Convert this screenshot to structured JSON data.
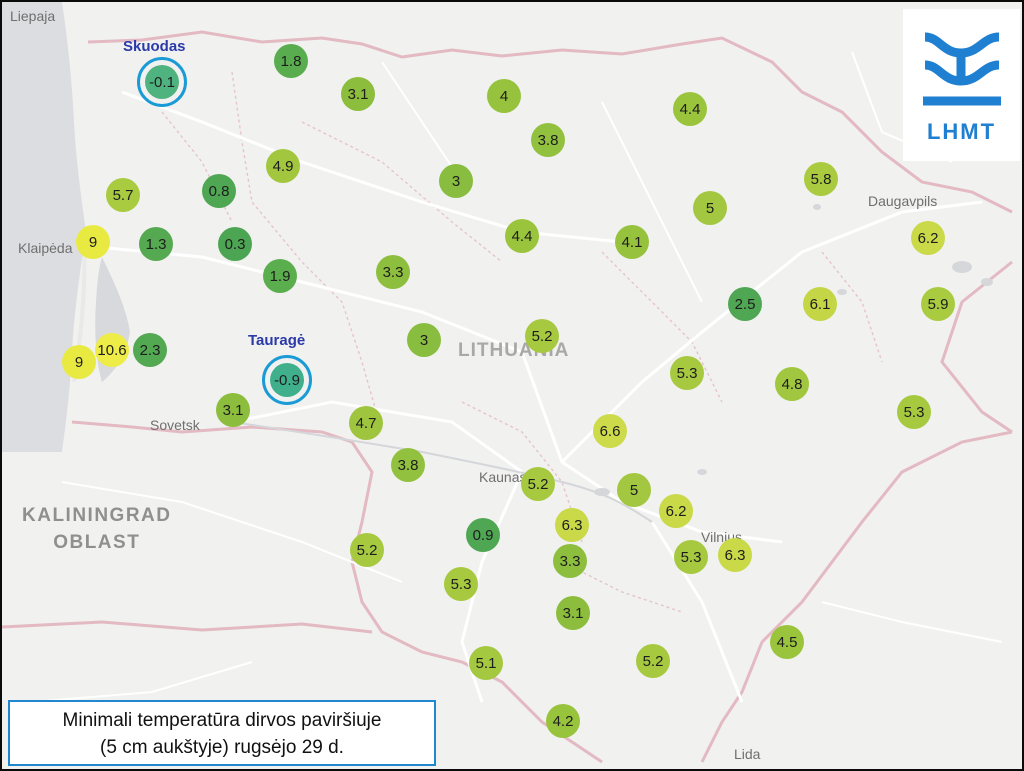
{
  "map": {
    "places": [
      {
        "name": "Liepaja",
        "kind": "city"
      },
      {
        "name": "Klaipėda",
        "kind": "city"
      },
      {
        "name": "Sovetsk",
        "kind": "city"
      },
      {
        "name": "Kaunas",
        "kind": "city"
      },
      {
        "name": "Vilnius",
        "kind": "city"
      },
      {
        "name": "Daugavpils",
        "kind": "city"
      },
      {
        "name": "Lida",
        "kind": "city"
      },
      {
        "name": "KALININGRAD OBLAST",
        "kind": "region"
      },
      {
        "name": "LITHUANIA",
        "kind": "country"
      }
    ],
    "highlighted_stations": [
      "Skuodas",
      "Tauragė"
    ]
  },
  "measurements": [
    {
      "station": "Skuodas",
      "value": "-0.1",
      "color": "#4fb37f",
      "highlighted": true
    },
    {
      "station": "",
      "value": "1.8",
      "color": "#59ad4f"
    },
    {
      "station": "",
      "value": "3.1",
      "color": "#8cbd3d"
    },
    {
      "station": "",
      "value": "4",
      "color": "#96c23d"
    },
    {
      "station": "",
      "value": "3.8",
      "color": "#92c13f"
    },
    {
      "station": "",
      "value": "4.4",
      "color": "#9bc43d"
    },
    {
      "station": "",
      "value": "4.9",
      "color": "#a2c73f"
    },
    {
      "station": "",
      "value": "5.7",
      "color": "#a9cb40"
    },
    {
      "station": "",
      "value": "0.8",
      "color": "#4fa653"
    },
    {
      "station": "",
      "value": "3",
      "color": "#89bd3f"
    },
    {
      "station": "",
      "value": "5.8",
      "color": "#aacb40"
    },
    {
      "station": "",
      "value": "5",
      "color": "#a3c740"
    },
    {
      "station": "",
      "value": "9",
      "color": "#e8ea42"
    },
    {
      "station": "",
      "value": "1.3",
      "color": "#55a950"
    },
    {
      "station": "",
      "value": "0.3",
      "color": "#4ca552"
    },
    {
      "station": "",
      "value": "4.4",
      "color": "#9bc43d"
    },
    {
      "station": "",
      "value": "4.1",
      "color": "#97c23d"
    },
    {
      "station": "",
      "value": "6.2",
      "color": "#c9d948"
    },
    {
      "station": "",
      "value": "1.9",
      "color": "#5bae4e"
    },
    {
      "station": "",
      "value": "3.3",
      "color": "#8dbe3e"
    },
    {
      "station": "",
      "value": "2.5",
      "color": "#4fa653"
    },
    {
      "station": "",
      "value": "6.1",
      "color": "#c4d646"
    },
    {
      "station": "",
      "value": "5.9",
      "color": "#a9cb40"
    },
    {
      "station": "",
      "value": "3",
      "color": "#89bd3f"
    },
    {
      "station": "",
      "value": "5.2",
      "color": "#a6c940"
    },
    {
      "station": "",
      "value": "9",
      "color": "#e8ea42"
    },
    {
      "station": "",
      "value": "10.6",
      "color": "#eeec46"
    },
    {
      "station": "",
      "value": "2.3",
      "color": "#53a852"
    },
    {
      "station": "Tauragė",
      "value": "-0.9",
      "color": "#3fb08b",
      "highlighted": true
    },
    {
      "station": "",
      "value": "5.3",
      "color": "#a6c940"
    },
    {
      "station": "",
      "value": "4.8",
      "color": "#a1c63f"
    },
    {
      "station": "",
      "value": "5.3",
      "color": "#a6c940"
    },
    {
      "station": "",
      "value": "3.1",
      "color": "#8cbd3d"
    },
    {
      "station": "",
      "value": "4.7",
      "color": "#9fc53e"
    },
    {
      "station": "",
      "value": "6.6",
      "color": "#cddb4a"
    },
    {
      "station": "",
      "value": "3.8",
      "color": "#92c13f"
    },
    {
      "station": "",
      "value": "5.2",
      "color": "#a6c940"
    },
    {
      "station": "",
      "value": "5",
      "color": "#a3c740"
    },
    {
      "station": "",
      "value": "6.2",
      "color": "#c9d948"
    },
    {
      "station": "",
      "value": "0.9",
      "color": "#4fa653"
    },
    {
      "station": "",
      "value": "6.3",
      "color": "#c9d948"
    },
    {
      "station": "",
      "value": "5.2",
      "color": "#a6c940"
    },
    {
      "station": "",
      "value": "3.3",
      "color": "#8dbe3e"
    },
    {
      "station": "",
      "value": "5.3",
      "color": "#a6c940"
    },
    {
      "station": "",
      "value": "6.3",
      "color": "#c9d948"
    },
    {
      "station": "",
      "value": "5.3",
      "color": "#a6c940"
    },
    {
      "station": "",
      "value": "3.1",
      "color": "#8cbd3d"
    },
    {
      "station": "",
      "value": "4.5",
      "color": "#9bc43d"
    },
    {
      "station": "",
      "value": "5.1",
      "color": "#a4c840"
    },
    {
      "station": "",
      "value": "5.2",
      "color": "#a6c940"
    },
    {
      "station": "",
      "value": "4.2",
      "color": "#98c33d"
    }
  ],
  "logo": {
    "text": "LHMT",
    "color": "#1f7fd0"
  },
  "caption": {
    "line1": "Minimali temperatūra dirvos paviršiuje",
    "line2": "(5 cm aukštyje) rugsėjo 29 d."
  }
}
